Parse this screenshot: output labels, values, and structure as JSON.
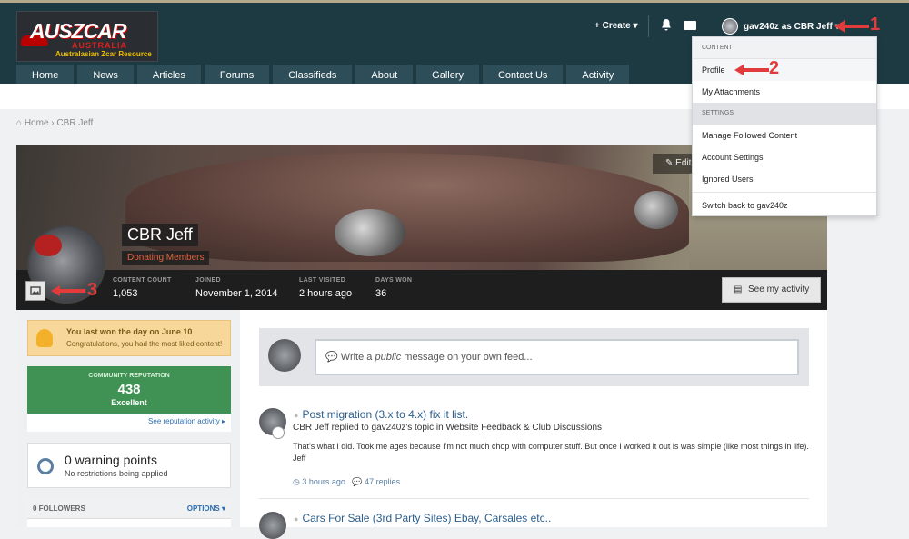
{
  "logo": {
    "main": "AUSZCAR",
    "country": "AUSTRALIA",
    "tagline": "Australasian Zcar Resource"
  },
  "nav": {
    "tabs": [
      "Home",
      "News",
      "Articles",
      "Forums",
      "Classifieds",
      "About",
      "Gallery",
      "Contact Us",
      "Activity"
    ]
  },
  "userbar": {
    "create": "+ Create ▾",
    "user": "gav240z as CBR Jeff ▾"
  },
  "annotations": {
    "n1": "1",
    "n2": "2",
    "n3": "3",
    "color": "#e23b3b"
  },
  "dropdown": {
    "section1": "CONTENT",
    "profile": "Profile",
    "attachments": "My Attachments",
    "section2": "SETTINGS",
    "followed": "Manage Followed Content",
    "account": "Account Settings",
    "ignored": "Ignored Users",
    "switch": "Switch back to gav240z"
  },
  "breadcrumb": {
    "home": "Home",
    "current": "CBR Jeff"
  },
  "profile": {
    "name": "CBR Jeff",
    "role": "Donating Members",
    "edit": "Edit",
    "stats": [
      {
        "key": "CONTENT COUNT",
        "value": "1,053"
      },
      {
        "key": "JOINED",
        "value": "November 1, 2014"
      },
      {
        "key": "LAST VISITED",
        "value": "2 hours ago"
      },
      {
        "key": "DAYS WON",
        "value": "36"
      }
    ],
    "see_activity": "See my activity"
  },
  "sidebar": {
    "trophy_title": "You last won the day on June 10",
    "trophy_sub": "Congratulations, you had the most liked content!",
    "rep_label": "COMMUNITY REPUTATION",
    "rep_value": "438",
    "rep_status": "Excellent",
    "rep_link": "See reputation activity ▸",
    "warn_title": "0 warning points",
    "warn_sub": "No restrictions being applied",
    "followers": "0 FOLLOWERS",
    "options": "OPTIONS ▾"
  },
  "composer": {
    "pre": "Write a ",
    "em": "public",
    "post": " message on your own feed..."
  },
  "feed": [
    {
      "title": "Post migration (3.x to 4.x) fix it list.",
      "sub": "CBR Jeff replied to gav240z's topic in Website Feedback & Club Discussions",
      "body": "That's what I did. Took me ages because I'm not much chop with computer stuff. But once I worked it out is was simple (like most things in life). Jeff",
      "time": "3 hours ago",
      "replies": "47 replies"
    },
    {
      "title": "Cars For Sale (3rd Party Sites) Ebay, Carsales etc..",
      "sub": "",
      "body": "",
      "time": "",
      "replies": ""
    }
  ]
}
